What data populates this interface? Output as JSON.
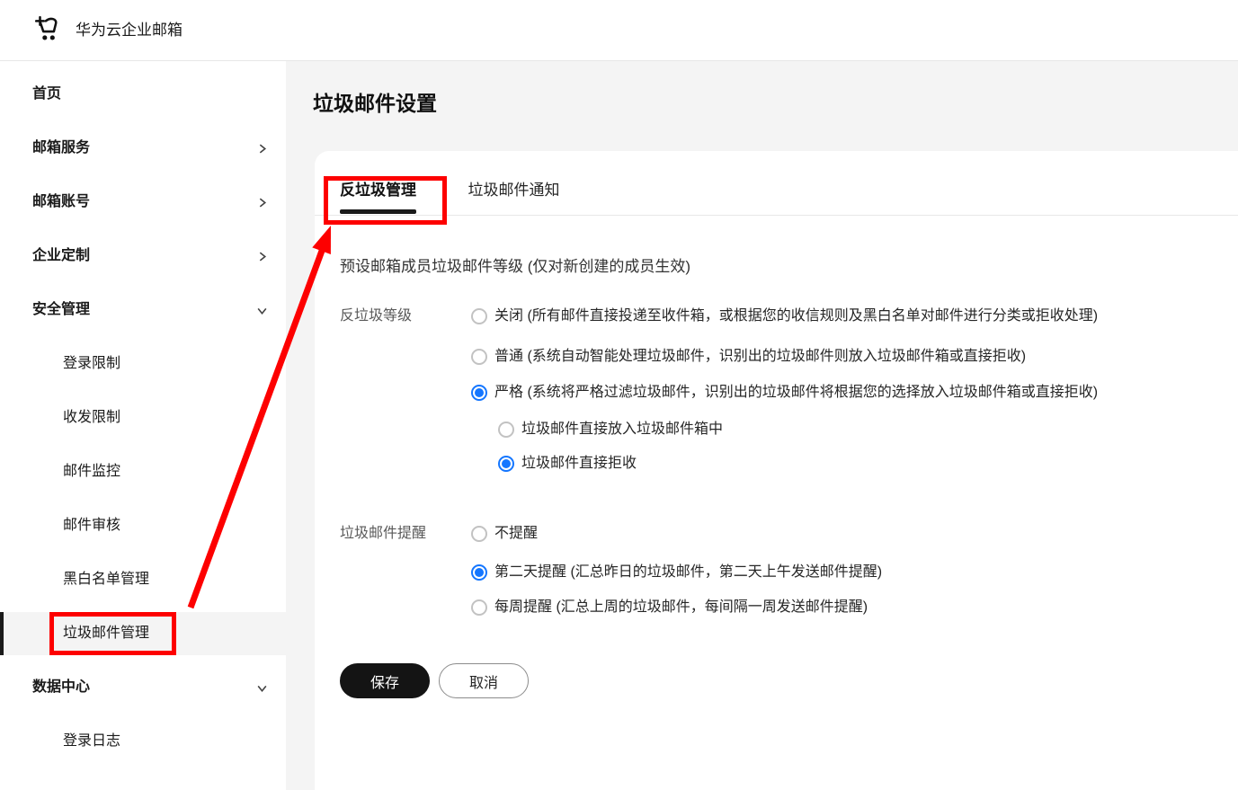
{
  "colors": {
    "annotation_red": "#fd0000",
    "radio_blue": "#1476ff",
    "save_button_bg": "#141414"
  },
  "header": {
    "app_title": "华为云企业邮箱",
    "logo_icon": "cart-sparkle-icon"
  },
  "sidebar": {
    "items": [
      {
        "label": "首页"
      },
      {
        "label": "邮箱服务",
        "chevron": "right"
      },
      {
        "label": "邮箱账号",
        "chevron": "right"
      },
      {
        "label": "企业定制",
        "chevron": "right"
      },
      {
        "label": "安全管理",
        "chevron": "down"
      },
      {
        "label": "登录限制",
        "sub": true
      },
      {
        "label": "收发限制",
        "sub": true
      },
      {
        "label": "邮件监控",
        "sub": true
      },
      {
        "label": "邮件审核",
        "sub": true
      },
      {
        "label": "黑白名单管理",
        "sub": true
      },
      {
        "label": "垃圾邮件管理",
        "sub": true,
        "active": true
      },
      {
        "label": "数据中心",
        "chevron": "down"
      },
      {
        "label": "登录日志",
        "sub": true
      }
    ]
  },
  "main": {
    "page_title": "垃圾邮件设置",
    "tabs": [
      {
        "label": "反垃圾管理",
        "active": true
      },
      {
        "label": "垃圾邮件通知",
        "active": false
      }
    ],
    "preset_heading": "预设邮箱成员垃圾邮件等级 (仅对新创建的成员生效)",
    "anti_spam_level": {
      "label": "反垃圾等级",
      "options": [
        {
          "label": "关闭 (所有邮件直接投递至收件箱，或根据您的收信规则及黑白名单对邮件进行分类或拒收处理)",
          "selected": false
        },
        {
          "label": "普通 (系统自动智能处理垃圾邮件，识别出的垃圾邮件则放入垃圾邮件箱或直接拒收)",
          "selected": false
        },
        {
          "label": "严格 (系统将严格过滤垃圾邮件，识别出的垃圾邮件将根据您的选择放入垃圾邮件箱或直接拒收)",
          "selected": true
        }
      ],
      "sub_options": [
        {
          "label": "垃圾邮件直接放入垃圾邮件箱中",
          "selected": false
        },
        {
          "label": "垃圾邮件直接拒收",
          "selected": true
        }
      ]
    },
    "spam_reminder": {
      "label": "垃圾邮件提醒",
      "options": [
        {
          "label": "不提醒",
          "selected": false
        },
        {
          "label": "第二天提醒 (汇总昨日的垃圾邮件，第二天上午发送邮件提醒)",
          "selected": true
        },
        {
          "label": "每周提醒 (汇总上周的垃圾邮件，每间隔一周发送邮件提醒)",
          "selected": false
        }
      ]
    },
    "buttons": {
      "save": "保存",
      "cancel": "取消"
    }
  }
}
